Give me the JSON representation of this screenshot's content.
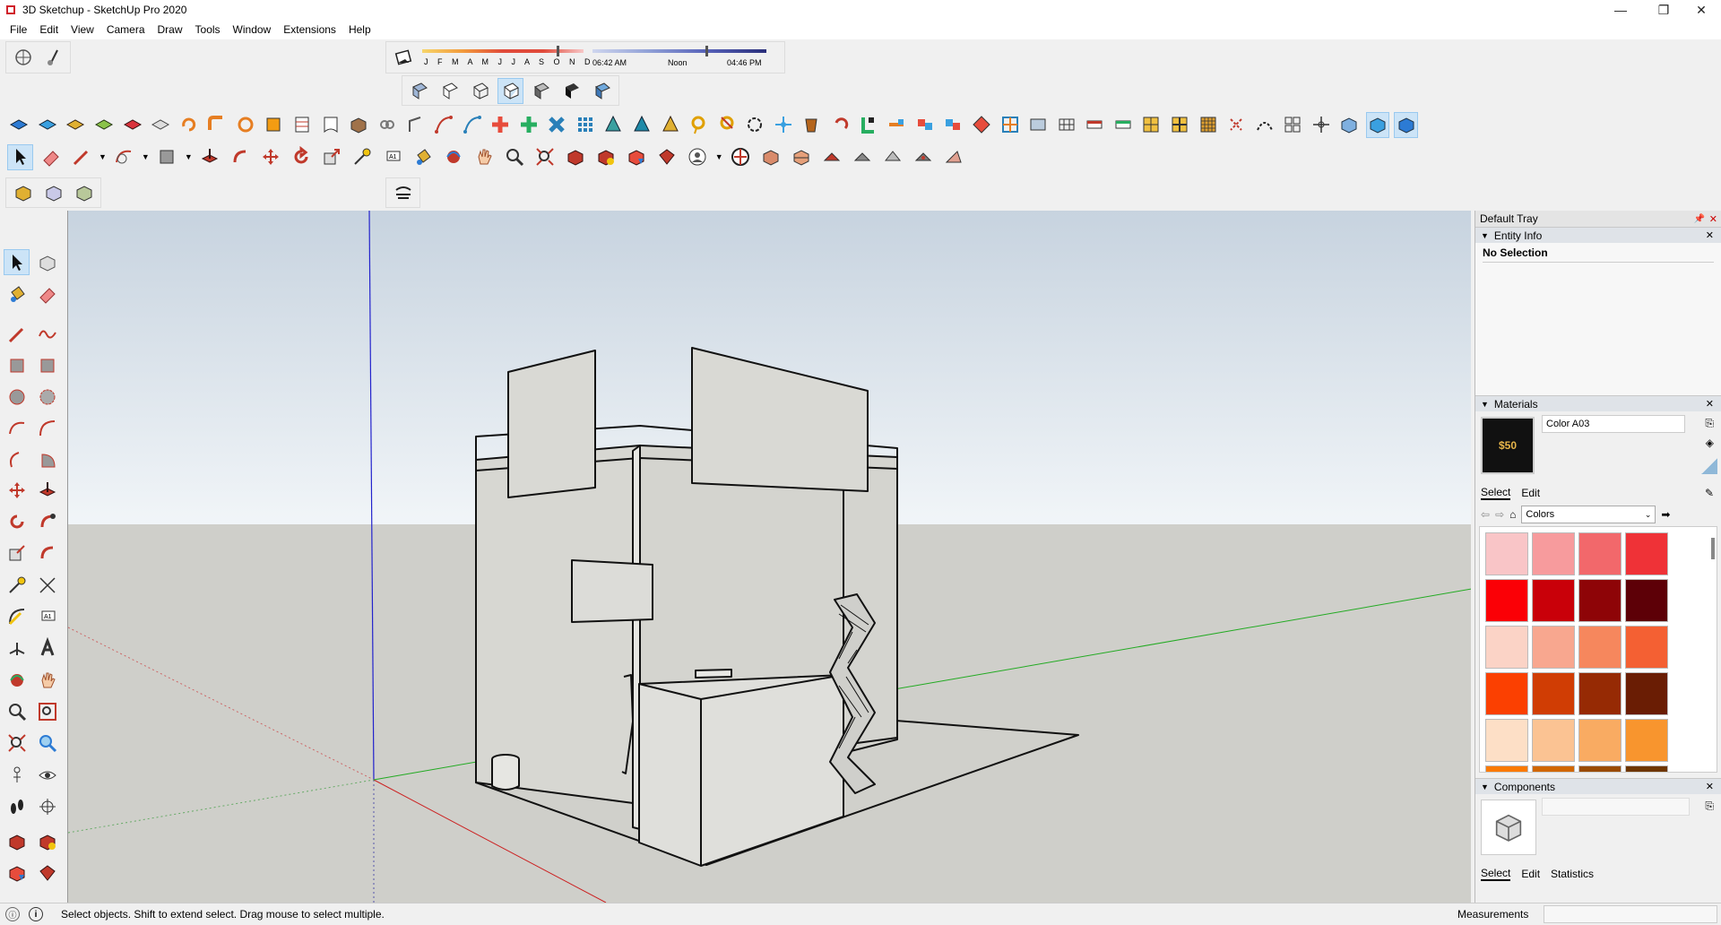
{
  "window": {
    "title": "3D Sketchup - SketchUp Pro 2020",
    "controls": [
      "—",
      "❐",
      "✕"
    ]
  },
  "menu": [
    "File",
    "Edit",
    "View",
    "Camera",
    "Draw",
    "Tools",
    "Window",
    "Extensions",
    "Help"
  ],
  "shadows": {
    "months": "J F M A M J J A S O N D",
    "time_start": "06:42 AM",
    "time_mid": "Noon",
    "time_end": "04:46 PM"
  },
  "tray": {
    "title": "Default Tray",
    "entity_info": {
      "header": "Entity Info",
      "selection": "No Selection"
    },
    "materials": {
      "header": "Materials",
      "material_name": "Color A03",
      "thumb_price": "$50",
      "tabs": [
        "Select",
        "Edit"
      ],
      "library": "Colors",
      "swatch_colors": [
        "#f9c5c7",
        "#f79b9d",
        "#f2686b",
        "#ef3237",
        "#fb0006",
        "#c90009",
        "#8e0407",
        "#5d0007",
        "#fbd3c6",
        "#f8a78f",
        "#f6875d",
        "#f46033",
        "#fb4001",
        "#d03d04",
        "#962a04",
        "#6a1d04",
        "#fddfc6",
        "#fbc393",
        "#f9ab62",
        "#f8952e",
        "#fb7a01",
        "#d16700",
        "#9a4b00",
        "#6e3600"
      ]
    },
    "components": {
      "header": "Components",
      "tabs": [
        "Select",
        "Edit",
        "Statistics"
      ]
    }
  },
  "status": {
    "message": "Select objects. Shift to extend select. Drag mouse to select multiple.",
    "measurements_label": "Measurements",
    "measurements_value": ""
  }
}
